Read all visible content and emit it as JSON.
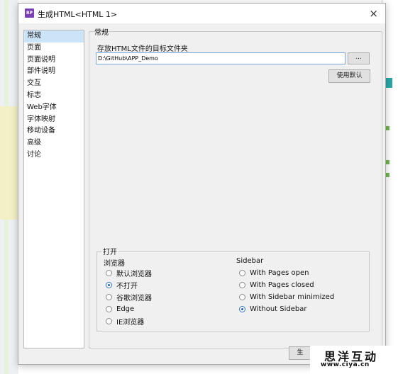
{
  "window": {
    "title": "生成HTML<HTML 1>",
    "app_icon_text": "RP",
    "close_glyph": "×",
    "accent_color": "#7a3fb8"
  },
  "nav": {
    "items": [
      {
        "label": "常规",
        "selected": true
      },
      {
        "label": "页面",
        "selected": false
      },
      {
        "label": "页面说明",
        "selected": false
      },
      {
        "label": "部件说明",
        "selected": false
      },
      {
        "label": "交互",
        "selected": false
      },
      {
        "label": "标志",
        "selected": false
      },
      {
        "label": "Web字体",
        "selected": false
      },
      {
        "label": "字体映射",
        "selected": false
      },
      {
        "label": "移动设备",
        "selected": false
      },
      {
        "label": "高级",
        "selected": false
      },
      {
        "label": "讨论",
        "selected": false
      }
    ]
  },
  "general": {
    "section_title": "常规",
    "folder_label": "存放HTML文件的目标文件夹",
    "folder_value": "D:\\GitHub\\APP_Demo",
    "browse_label": "...",
    "default_label": "使用默认"
  },
  "open_group": {
    "title": "打开",
    "browser": {
      "heading": "浏览器",
      "options": [
        {
          "label": "默认浏览器",
          "checked": false
        },
        {
          "label": "不打开",
          "checked": true
        },
        {
          "label": "谷歌浏览器",
          "checked": false
        },
        {
          "label": "Edge",
          "checked": false
        },
        {
          "label": "IE浏览器",
          "checked": false
        }
      ]
    },
    "sidebar": {
      "heading": "Sidebar",
      "options": [
        {
          "label": "With Pages open",
          "checked": false
        },
        {
          "label": "With Pages closed",
          "checked": false
        },
        {
          "label": "With Sidebar minimized",
          "checked": false
        },
        {
          "label": "Without Sidebar",
          "checked": true
        }
      ]
    }
  },
  "footer": {
    "ok_partial": "生"
  },
  "watermark": {
    "name": "思洋互动",
    "url": "www.ciya.cn"
  }
}
